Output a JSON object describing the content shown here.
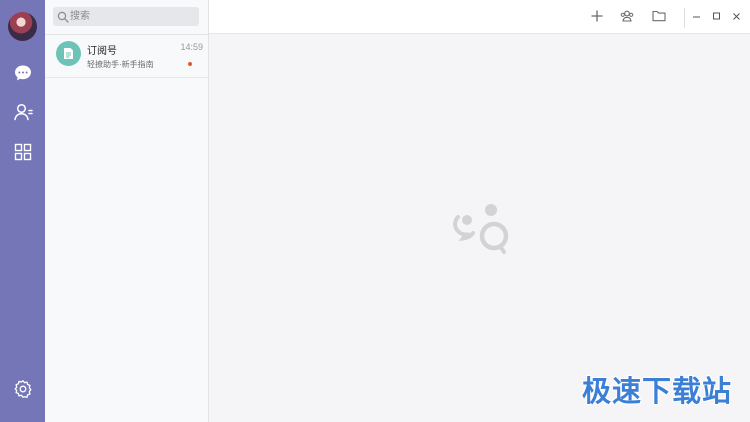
{
  "search": {
    "placeholder": "搜索"
  },
  "conversation": {
    "title": "订阅号",
    "time": "14:59",
    "preview": "轻撩助手·新手指南",
    "unread_color": "#e25a2a"
  },
  "sidebar": {
    "items": [
      {
        "icon": "chat-bubble-icon"
      },
      {
        "icon": "contacts-icon"
      },
      {
        "icon": "apps-grid-icon"
      },
      {
        "icon": "gear-icon"
      }
    ]
  },
  "header": {
    "actions": [
      {
        "icon": "plus-icon"
      },
      {
        "icon": "group-icon"
      },
      {
        "icon": "folder-icon"
      }
    ],
    "window": [
      {
        "icon": "minimize-icon"
      },
      {
        "icon": "maximize-icon"
      },
      {
        "icon": "close-icon"
      }
    ]
  },
  "watermark": "极速下载站",
  "colors": {
    "rail": "#7576b7",
    "conversation_icon": "#6dc3b7",
    "watermark": "#3b7fd6"
  }
}
